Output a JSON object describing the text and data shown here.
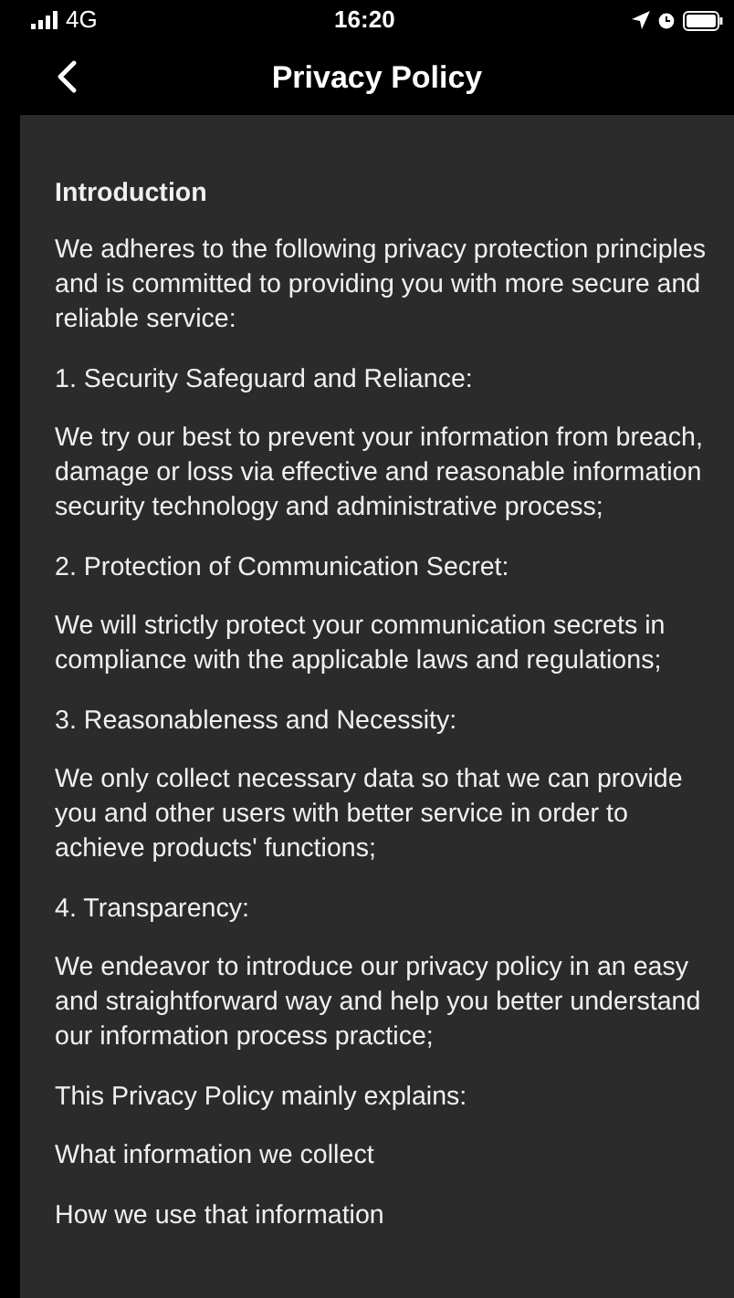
{
  "status_bar": {
    "carrier": "4G",
    "time": "16:20"
  },
  "nav": {
    "title": "Privacy Policy"
  },
  "content": {
    "heading": "Introduction",
    "paragraphs": [
      "We adheres to the following privacy protection principles and is committed to providing you with more secure and reliable service:",
      "1. Security Safeguard and Reliance:",
      "We try our best to prevent your information from breach, damage or loss via effective and reasonable information security technology and administrative process;",
      "2. Protection of Communication Secret:",
      "We will strictly protect your communication secrets in compliance with the applicable laws and regulations;",
      "3. Reasonableness and Necessity:",
      "We only collect necessary data so that we can provide you and other users with better service in order to achieve products' functions;",
      "4. Transparency:",
      "We endeavor to introduce our privacy policy in an easy and straightforward way and help you better understand our information process practice;",
      "This Privacy Policy mainly explains:",
      "What information we collect",
      "How we use that information"
    ]
  }
}
